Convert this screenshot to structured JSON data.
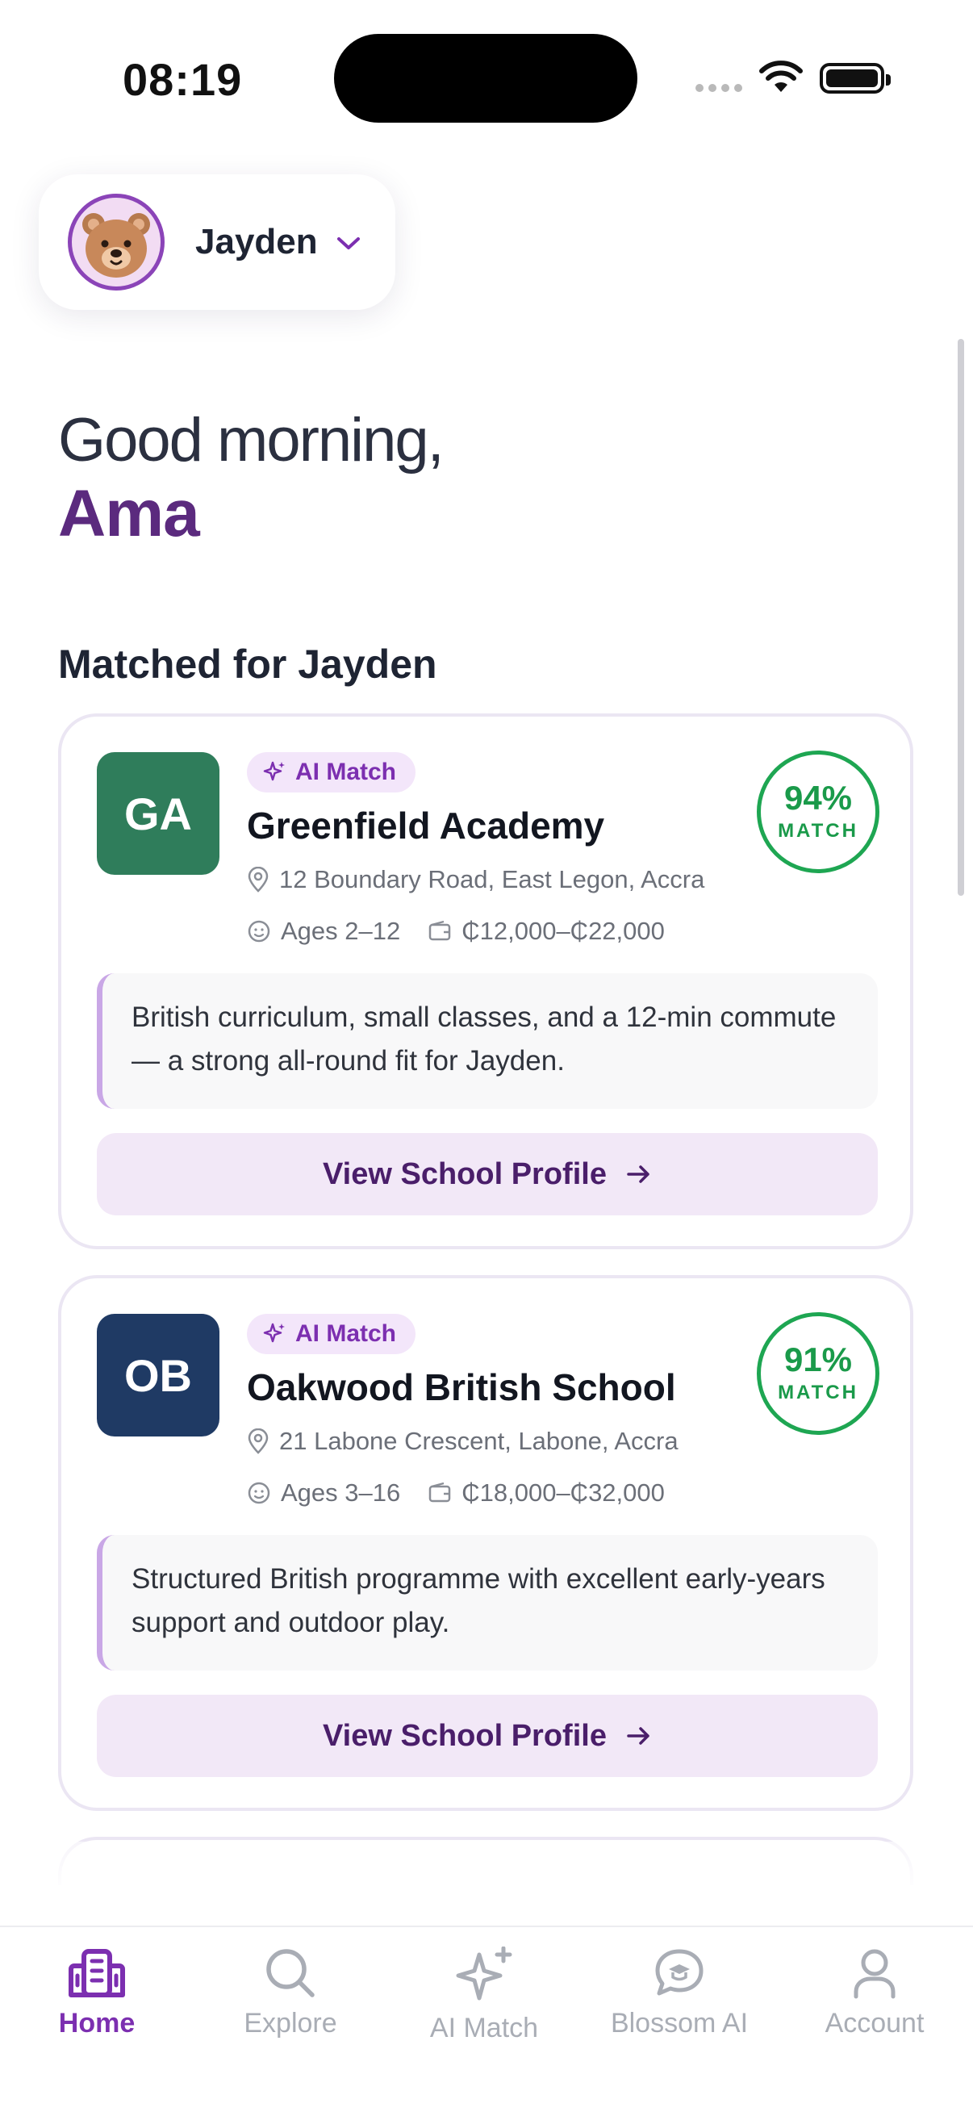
{
  "status_bar": {
    "time": "08:19"
  },
  "child_selector": {
    "name": "Jayden",
    "avatar": "bear-avatar"
  },
  "greeting": {
    "line1": "Good morning,",
    "name": "Ama"
  },
  "section": {
    "title": "Matched for Jayden"
  },
  "schools": [
    {
      "initials": "GA",
      "logo_color": "#2f7d5b",
      "badge": "AI Match",
      "name": "Greenfield Academy",
      "address": "12 Boundary Road, East Legon, Accra",
      "ages": "Ages 2–12",
      "fees": "₵12,000–₵22,000",
      "match_pct": "94%",
      "match_label": "MATCH",
      "summary": "British curriculum, small classes, and a 12-min commute — a strong all-round fit for Jayden.",
      "cta": "View School Profile"
    },
    {
      "initials": "OB",
      "logo_color": "#1f3a64",
      "badge": "AI Match",
      "name": "Oakwood British School",
      "address": "21 Labone Crescent, Labone, Accra",
      "ages": "Ages 3–16",
      "fees": "₵18,000–₵32,000",
      "match_pct": "91%",
      "match_label": "MATCH",
      "summary": "Structured British programme with excellent early-years support and outdoor play.",
      "cta": "View School Profile"
    }
  ],
  "tabbar": {
    "items": [
      {
        "label": "Home",
        "icon": "school-building-icon",
        "active": true
      },
      {
        "label": "Explore",
        "icon": "search-icon",
        "active": false
      },
      {
        "label": "AI Match",
        "icon": "sparkle-icon",
        "active": false
      },
      {
        "label": "Blossom AI",
        "icon": "chat-bubble-icon",
        "active": false
      },
      {
        "label": "Account",
        "icon": "user-icon",
        "active": false
      }
    ]
  },
  "colors": {
    "brand": "#5b2a7e",
    "accent": "#7c2fb0",
    "match_green": "#1ea652"
  }
}
